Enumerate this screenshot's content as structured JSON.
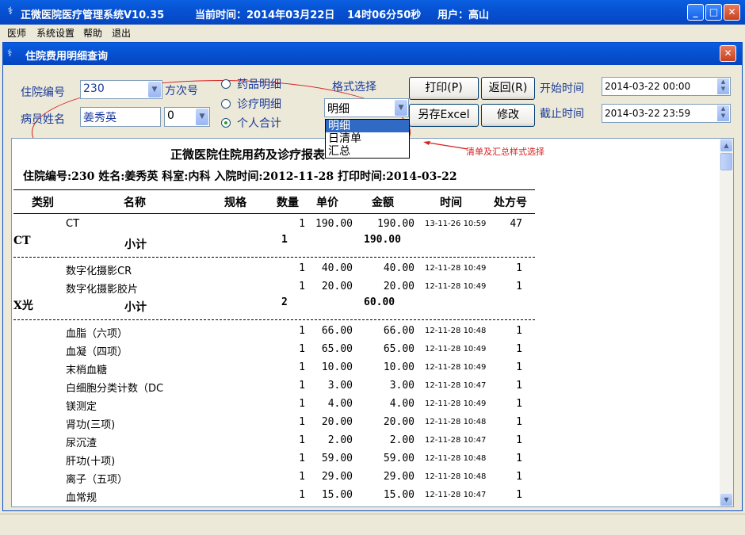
{
  "window": {
    "system_name": "正微医院医疗管理系统V10.35",
    "time_label": "当前时间：2014年03月22日",
    "time_value": "14时06分50秒",
    "user_label": "用户：高山"
  },
  "menu": [
    "医师",
    "系统设置",
    "帮助",
    "退出"
  ],
  "child": {
    "title": "住院费用明细查询"
  },
  "form": {
    "inpatient_no_label": "住院编号",
    "inpatient_no_value": "230",
    "visit_label": "方次号",
    "patient_name_label": "病员姓名",
    "patient_name_value": "姜秀英",
    "visit_value": "0",
    "radios": [
      {
        "label": "药品明细",
        "checked": false
      },
      {
        "label": "诊疗明细",
        "checked": false
      },
      {
        "label": "个人合计",
        "checked": true
      }
    ],
    "format_label": "格式选择",
    "format_value": "明细",
    "format_options": [
      "明细",
      "日清单",
      "汇总"
    ],
    "print_button": "打印(P)",
    "back_button": "返回(R)",
    "excel_button": "另存Excel",
    "modify_button": "修改",
    "start_label": "开始时间",
    "start_value": "2014-03-22 00:00",
    "end_label": "截止时间",
    "end_value": "2014-03-22 23:59"
  },
  "annotation": {
    "text": "清单及汇总样式选择"
  },
  "report": {
    "title": "正微医院住院用药及诊疗报表",
    "info": "住院编号:230 姓名:姜秀英  科室:内科 入院时间:2012-11-28 打印时间:2014-03-22",
    "headers": [
      "类别",
      "名称",
      "规格",
      "数量",
      "单价",
      "金额",
      "时间",
      "处方号"
    ],
    "groups": [
      {
        "category": "CT",
        "rows": [
          {
            "name": "CT",
            "spec": "",
            "qty": "1",
            "price": "190.00",
            "amount": "190.00",
            "time": "13-11-26 10:59",
            "rx": "47"
          }
        ],
        "subtotal_label": "小计",
        "subtotal_qty": "1",
        "subtotal_amount": "190.00"
      },
      {
        "category": "X光",
        "rows": [
          {
            "name": "数字化摄影CR",
            "spec": "",
            "qty": "1",
            "price": "40.00",
            "amount": "40.00",
            "time": "12-11-28 10:49",
            "rx": "1"
          },
          {
            "name": "数字化摄影胶片",
            "spec": "",
            "qty": "1",
            "price": "20.00",
            "amount": "20.00",
            "time": "12-11-28 10:49",
            "rx": "1"
          }
        ],
        "subtotal_label": "小计",
        "subtotal_qty": "2",
        "subtotal_amount": "60.00"
      },
      {
        "category": "",
        "rows": [
          {
            "name": "血脂（六项）",
            "spec": "",
            "qty": "1",
            "price": "66.00",
            "amount": "66.00",
            "time": "12-11-28 10:48",
            "rx": "1"
          },
          {
            "name": "血凝（四项）",
            "spec": "",
            "qty": "1",
            "price": "65.00",
            "amount": "65.00",
            "time": "12-11-28 10:49",
            "rx": "1"
          },
          {
            "name": "末梢血糖",
            "spec": "",
            "qty": "1",
            "price": "10.00",
            "amount": "10.00",
            "time": "12-11-28 10:49",
            "rx": "1"
          },
          {
            "name": "白细胞分类计数（DC",
            "spec": "",
            "qty": "1",
            "price": "3.00",
            "amount": "3.00",
            "time": "12-11-28 10:47",
            "rx": "1"
          },
          {
            "name": "镁测定",
            "spec": "",
            "qty": "1",
            "price": "4.00",
            "amount": "4.00",
            "time": "12-11-28 10:49",
            "rx": "1"
          },
          {
            "name": "肾功(三项)",
            "spec": "",
            "qty": "1",
            "price": "20.00",
            "amount": "20.00",
            "time": "12-11-28 10:48",
            "rx": "1"
          },
          {
            "name": "尿沉渣",
            "spec": "",
            "qty": "1",
            "price": "2.00",
            "amount": "2.00",
            "time": "12-11-28 10:47",
            "rx": "1"
          },
          {
            "name": "肝功(十项)",
            "spec": "",
            "qty": "1",
            "price": "59.00",
            "amount": "59.00",
            "time": "12-11-28 10:48",
            "rx": "1"
          },
          {
            "name": "离子（五项）",
            "spec": "",
            "qty": "1",
            "price": "29.00",
            "amount": "29.00",
            "time": "12-11-28 10:48",
            "rx": "1"
          },
          {
            "name": "血常规",
            "spec": "",
            "qty": "1",
            "price": "15.00",
            "amount": "15.00",
            "time": "12-11-28 10:47",
            "rx": "1"
          }
        ]
      }
    ]
  },
  "colors": {
    "titlebar": "#0653D4",
    "label_blue": "#1A3A9A",
    "annotation_red": "#D81E1E",
    "selection": "#316AC5"
  }
}
